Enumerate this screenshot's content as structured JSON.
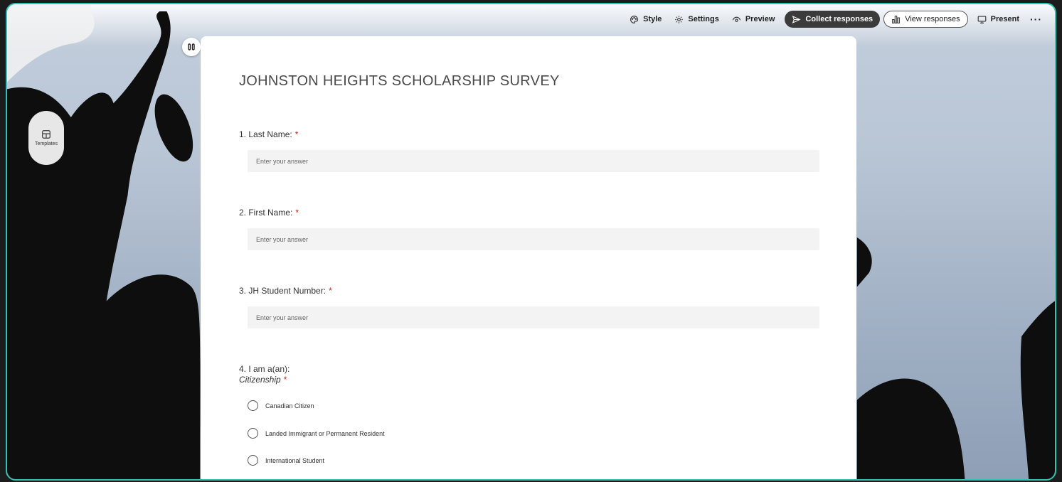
{
  "toolbar": {
    "style": "Style",
    "settings": "Settings",
    "preview": "Preview",
    "collect": "Collect responses",
    "view": "View responses",
    "present": "Present",
    "more": "···"
  },
  "sidebar": {
    "templates": "Templates"
  },
  "form": {
    "title": "JOHNSTON HEIGHTS SCHOLARSHIP SURVEY",
    "required_mark": "*",
    "questions": [
      {
        "label": "1. Last Name:",
        "placeholder": "Enter your answer"
      },
      {
        "label": "2. First Name:",
        "placeholder": "Enter your answer"
      },
      {
        "label": "3. JH Student Number:",
        "placeholder": "Enter your answer"
      },
      {
        "label": "4. I am a(an):",
        "subtitle": "Citizenship",
        "options": [
          "Canadian Citizen",
          "Landed Immigrant or Permanent Resident",
          "International Student"
        ]
      }
    ]
  },
  "colors": {
    "accent_border": "#2fc4b2",
    "required": "#b3261e",
    "primary_button": "#3b3b3b"
  }
}
